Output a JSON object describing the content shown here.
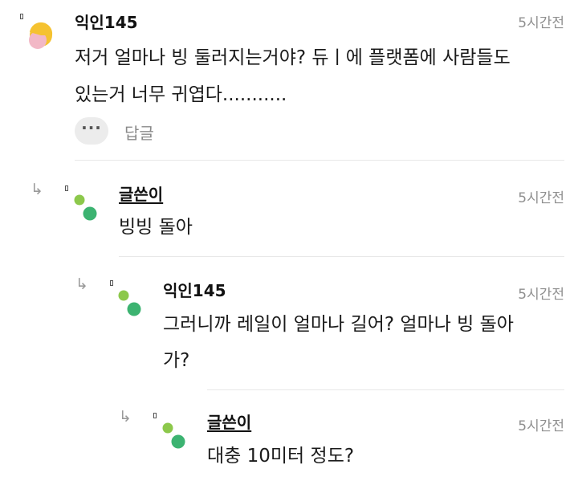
{
  "comments": [
    {
      "author": "익인145",
      "time": "5시간전",
      "lines": [
        "저거 얼마나 빙 둘러지는거야? 듀ㅣ에 플랫폼에 사람들도",
        "있는거 너무 귀엽다..........."
      ],
      "reply_label": "답글",
      "more_label": "···"
    },
    {
      "author": "글쓴이",
      "time": "5시간전",
      "lines": [
        "빙빙 돌아"
      ]
    },
    {
      "author": "익인145",
      "time": "5시간전",
      "lines": [
        "그러니까 레일이 얼마나 길어? 얼마나 빙 돌아",
        "가?"
      ]
    },
    {
      "author": "글쓴이",
      "time": "5시간전",
      "lines": [
        "대충 10미터 정도?"
      ]
    }
  ],
  "icons": {
    "reply_indicator": "reply-arrow-icon",
    "avatar_user": "yellow-pink-avatar-icon",
    "avatar_author": "green-dots-avatar-icon"
  },
  "colors": {
    "avatar_yellow": "#f5c230",
    "avatar_pink": "#f2b8c6",
    "avatar_green_light": "#8cc84b",
    "avatar_green_dark": "#3cb371",
    "time_gray": "#8f8f8f"
  }
}
